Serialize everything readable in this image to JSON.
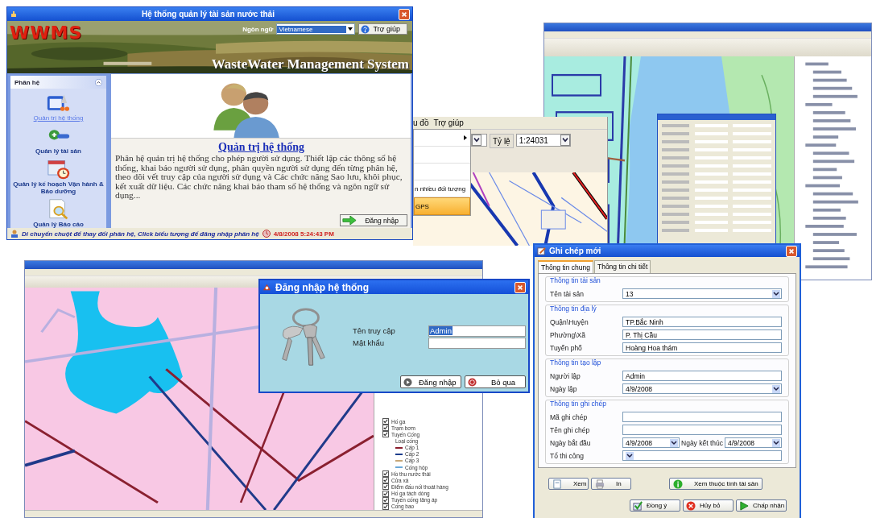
{
  "main_window": {
    "title": "Hệ thống quản lý tài sản nước thải",
    "logo": "WWMS",
    "language_label": "Ngôn ngữ",
    "language": "Vietnamese",
    "help_button": "Trợ giúp",
    "banner_subtitle": "WasteWater Management System",
    "sidebar": {
      "title": "Phân hệ",
      "items": [
        {
          "label": "Quản trị hệ thống",
          "selected": true
        },
        {
          "label": "Quản lý tài sản",
          "selected": false
        },
        {
          "label": "Quản lý kế hoạch Vận hành & Bảo dưỡng",
          "selected": false
        },
        {
          "label": "Quản lý Báo cáo",
          "selected": false
        }
      ]
    },
    "content": {
      "heading": "Quản trị hệ thống",
      "description": "Phân hệ quản trị hệ thống cho phép người sử dụng. Thiết lập các thông số hệ thống, khai báo người sử dụng, phân quyền người sử dụng đến từng phân hệ, theo dõi vết truy cập của người sử dụng và Các chức năng Sao lưu, khôi phục, kết xuất dữ liệu. Các chức năng khai báo tham số hệ thống và ngôn ngữ sử dụng..."
    },
    "login_button": "Đăng nhập",
    "status_bar": {
      "hint": "Di chuyển chuột để thay đổi phân hệ, Click biểu tượng để đăng nhập phân hệ",
      "datetime": "4/8/2008 5:24:43 PM"
    }
  },
  "map_fragment": {
    "menu": [
      "u đồ",
      "Trợ giúp"
    ],
    "menu_items": [
      {
        "label": "n nhiều đối tượng",
        "selected": false
      },
      {
        "label": "GPS",
        "selected": true
      }
    ],
    "scale_label": "Tỷ lệ",
    "scale": "1:24031"
  },
  "operations_window": {
    "legend": [
      {
        "kind": "layer",
        "label": "Hố ga",
        "checked": true
      },
      {
        "kind": "layer",
        "label": "Trạm bơm",
        "checked": true
      },
      {
        "kind": "layer",
        "label": "Tuyến Cống",
        "checked": true
      },
      {
        "kind": "caption",
        "label": "Loại cống"
      },
      {
        "kind": "line",
        "label": "Cấp 1",
        "color": "#8b1c2c"
      },
      {
        "kind": "line",
        "label": "Cấp 2",
        "color": "#1c3c8c"
      },
      {
        "kind": "line",
        "label": "Cấp 3",
        "color": "#c8a878"
      },
      {
        "kind": "line",
        "label": "Cống hộp",
        "color": "#6aa8d8"
      },
      {
        "kind": "layer",
        "label": "Hồ thu nước thải",
        "checked": true
      },
      {
        "kind": "layer",
        "label": "Cửa xả",
        "checked": true
      },
      {
        "kind": "layer",
        "label": "Điểm đấu nối thoát hàng",
        "checked": true
      },
      {
        "kind": "layer",
        "label": "Hố ga tách dòng",
        "checked": true
      },
      {
        "kind": "layer",
        "label": "Tuyến cống tăng áp",
        "checked": true
      },
      {
        "kind": "layer",
        "label": "Cống bao",
        "checked": true
      }
    ]
  },
  "login_dialog": {
    "title": "Đăng nhập hệ thống",
    "username_label": "Tên truy cập",
    "username": "Admin",
    "username_selected": true,
    "password_label": "Mật khẩu",
    "buttons": [
      "Đăng nhập",
      "Bỏ qua"
    ]
  },
  "record_dialog": {
    "title": "Ghi chép mới",
    "tabs": [
      {
        "label": "Thông tin chung",
        "selected": true
      },
      {
        "label": "Thông tin chi tiết",
        "selected": false
      }
    ],
    "groups": [
      {
        "title": "Thông tin tài sản",
        "rows": [
          {
            "kind": "combo",
            "label": "Tên tài sản",
            "value": "13"
          }
        ]
      },
      {
        "title": "Thông tin địa lý",
        "rows": [
          {
            "kind": "text",
            "label": "Quận\\Huyện",
            "value": "TP.Bắc Ninh"
          },
          {
            "kind": "text",
            "label": "Phường\\Xã",
            "value": "P. Thị Cầu"
          },
          {
            "kind": "text",
            "label": "Tuyến phố",
            "value": "Hoàng Hoa thám"
          }
        ]
      },
      {
        "title": "Thông tin tạo lập",
        "rows": [
          {
            "kind": "text",
            "label": "Người lập",
            "value": "Admin"
          },
          {
            "kind": "combo",
            "label": "Ngày lập",
            "value": "4/9/2008"
          }
        ]
      },
      {
        "title": "Thông tin ghi chép",
        "rows": [
          {
            "kind": "text",
            "label": "Mã ghi chép"
          },
          {
            "kind": "text",
            "label": "Tên ghi chép"
          },
          {
            "kind": "range",
            "label": "Ngày bắt đầu",
            "value": "4/9/2008",
            "label2": "Ngày kết thúc",
            "value2": "4/9/2008"
          },
          {
            "kind": "combo",
            "label": "Tổ thi công"
          }
        ]
      }
    ],
    "view_buttons": [
      "Xem",
      "In"
    ],
    "asset_button": "Xem thuộc tính tài sản",
    "buttons": [
      "Đồng ý",
      "Hủy bỏ",
      "Chấp nhận"
    ]
  }
}
